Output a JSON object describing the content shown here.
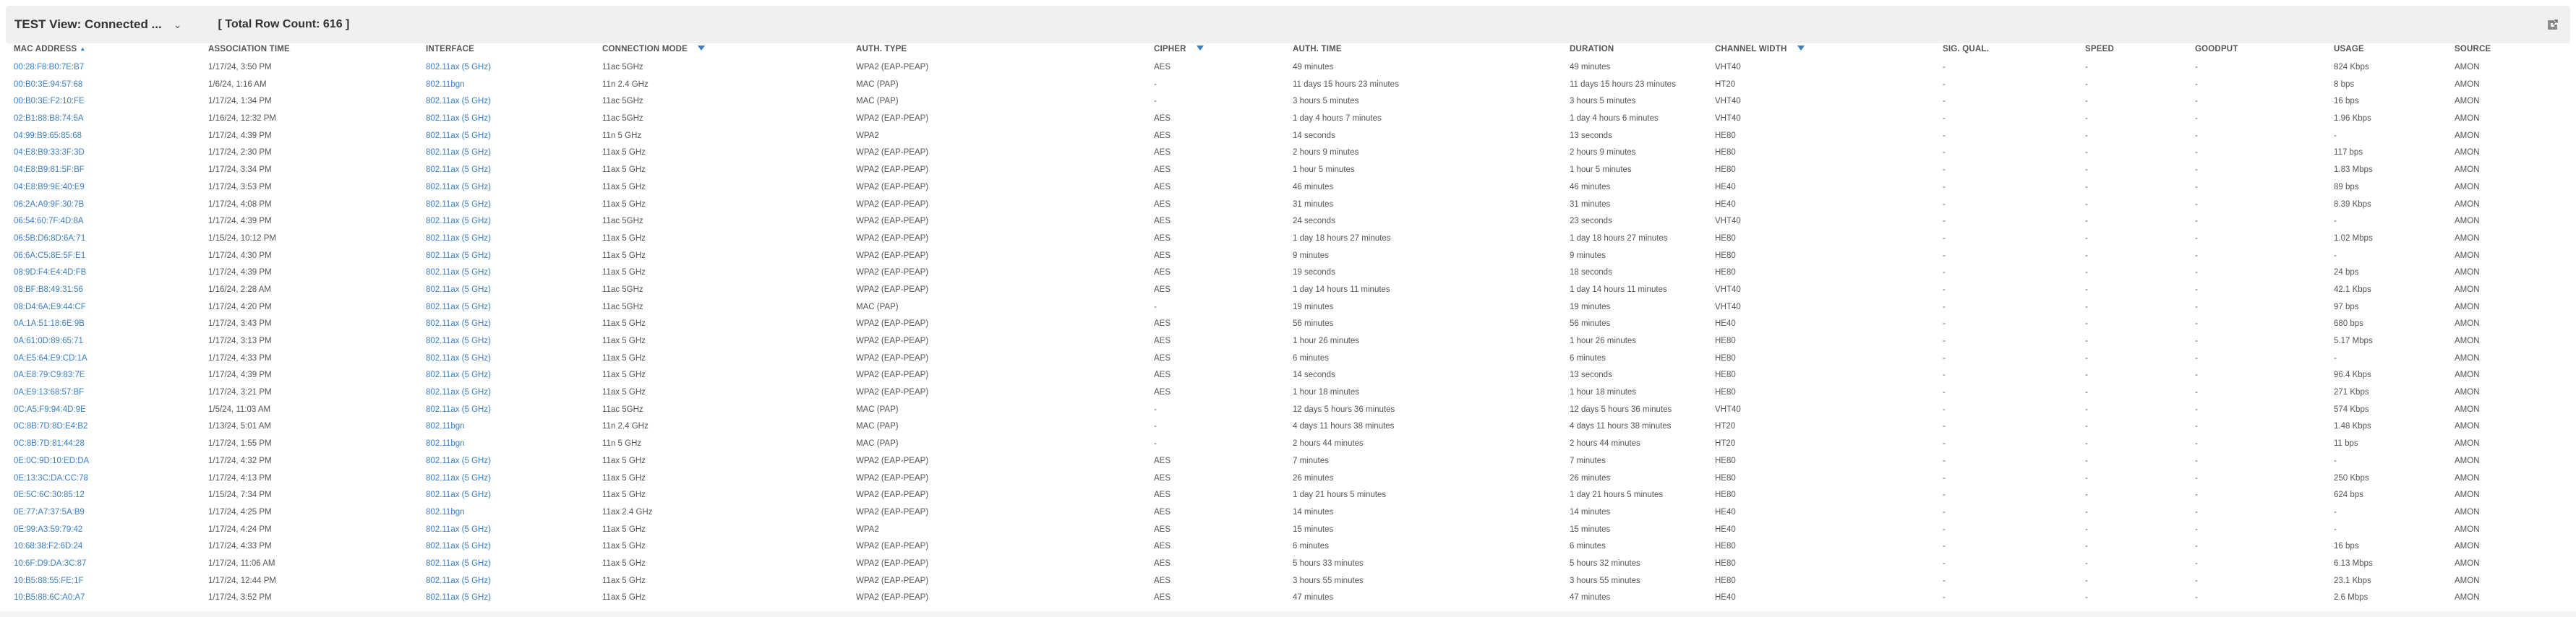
{
  "toolbar": {
    "view_name": "TEST View: Connected ...",
    "dropdown_glyph": "⌄",
    "row_count": "[ Total Row Count: 616 ]"
  },
  "table": {
    "columns": [
      "MAC ADDRESS",
      "ASSOCIATION TIME",
      "INTERFACE",
      "CONNECTION MODE",
      "AUTH. TYPE",
      "CIPHER",
      "AUTH. TIME",
      "DURATION",
      "CHANNEL WIDTH",
      "SIG. QUAL.",
      "SPEED",
      "GOODPUT",
      "USAGE",
      "SOURCE"
    ],
    "rows": [
      [
        "00:28:F8:B0:7E:B7",
        "1/17/24, 3:50 PM",
        "802.11ax (5 GHz)",
        "11ac 5GHz",
        "WPA2 (EAP-PEAP)",
        "AES",
        "49 minutes",
        "49 minutes",
        "VHT40",
        "-",
        "-",
        "-",
        "824 Kbps",
        "AMON"
      ],
      [
        "00:B0:3E:94:57:68",
        "1/6/24, 1:16 AM",
        "802.11bgn",
        "11n 2.4 GHz",
        "MAC (PAP)",
        "-",
        "11 days 15 hours 23 minutes",
        "11 days 15 hours 23 minutes",
        "HT20",
        "-",
        "-",
        "-",
        "8 bps",
        "AMON"
      ],
      [
        "00:B0:3E:F2:10:FE",
        "1/17/24, 1:34 PM",
        "802.11ax (5 GHz)",
        "11ac 5GHz",
        "MAC (PAP)",
        "-",
        "3 hours 5 minutes",
        "3 hours 5 minutes",
        "VHT40",
        "-",
        "-",
        "-",
        "16 bps",
        "AMON"
      ],
      [
        "02:B1:88:B8:74:5A",
        "1/16/24, 12:32 PM",
        "802.11ax (5 GHz)",
        "11ac 5GHz",
        "WPA2 (EAP-PEAP)",
        "AES",
        "1 day 4 hours 7 minutes",
        "1 day 4 hours 6 minutes",
        "VHT40",
        "-",
        "-",
        "-",
        "1.96 Kbps",
        "AMON"
      ],
      [
        "04:99:B9:65:85:68",
        "1/17/24, 4:39 PM",
        "802.11ax (5 GHz)",
        "11n 5 GHz",
        "WPA2",
        "AES",
        "14 seconds",
        "13 seconds",
        "HE80",
        "-",
        "-",
        "-",
        "-",
        "AMON"
      ],
      [
        "04:E8:B9:33:3F:3D",
        "1/17/24, 2:30 PM",
        "802.11ax (5 GHz)",
        "11ax 5 GHz",
        "WPA2 (EAP-PEAP)",
        "AES",
        "2 hours 9 minutes",
        "2 hours 9 minutes",
        "HE80",
        "-",
        "-",
        "-",
        "117 bps",
        "AMON"
      ],
      [
        "04:E8:B9:81:5F:BF",
        "1/17/24, 3:34 PM",
        "802.11ax (5 GHz)",
        "11ax 5 GHz",
        "WPA2 (EAP-PEAP)",
        "AES",
        "1 hour 5 minutes",
        "1 hour 5 minutes",
        "HE80",
        "-",
        "-",
        "-",
        "1.83 Mbps",
        "AMON"
      ],
      [
        "04:E8:B9:9E:40:E9",
        "1/17/24, 3:53 PM",
        "802.11ax (5 GHz)",
        "11ax 5 GHz",
        "WPA2 (EAP-PEAP)",
        "AES",
        "46 minutes",
        "46 minutes",
        "HE40",
        "-",
        "-",
        "-",
        "89 bps",
        "AMON"
      ],
      [
        "06:2A:A9:9F:30:7B",
        "1/17/24, 4:08 PM",
        "802.11ax (5 GHz)",
        "11ax 5 GHz",
        "WPA2 (EAP-PEAP)",
        "AES",
        "31 minutes",
        "31 minutes",
        "HE40",
        "-",
        "-",
        "-",
        "8.39 Kbps",
        "AMON"
      ],
      [
        "06:54:60:7F:4D:8A",
        "1/17/24, 4:39 PM",
        "802.11ax (5 GHz)",
        "11ac 5GHz",
        "WPA2 (EAP-PEAP)",
        "AES",
        "24 seconds",
        "23 seconds",
        "VHT40",
        "-",
        "-",
        "-",
        "-",
        "AMON"
      ],
      [
        "06:5B:D6:8D:6A:71",
        "1/15/24, 10:12 PM",
        "802.11ax (5 GHz)",
        "11ax 5 GHz",
        "WPA2 (EAP-PEAP)",
        "AES",
        "1 day 18 hours 27 minutes",
        "1 day 18 hours 27 minutes",
        "HE80",
        "-",
        "-",
        "-",
        "1.02 Mbps",
        "AMON"
      ],
      [
        "06:6A:C5:8E:5F:E1",
        "1/17/24, 4:30 PM",
        "802.11ax (5 GHz)",
        "11ax 5 GHz",
        "WPA2 (EAP-PEAP)",
        "AES",
        "9 minutes",
        "9 minutes",
        "HE80",
        "-",
        "-",
        "-",
        "-",
        "AMON"
      ],
      [
        "08:9D:F4:E4:4D:FB",
        "1/17/24, 4:39 PM",
        "802.11ax (5 GHz)",
        "11ax 5 GHz",
        "WPA2 (EAP-PEAP)",
        "AES",
        "19 seconds",
        "18 seconds",
        "HE80",
        "-",
        "-",
        "-",
        "24 bps",
        "AMON"
      ],
      [
        "08:BF:B8:49:31:56",
        "1/16/24, 2:28 AM",
        "802.11ax (5 GHz)",
        "11ac 5GHz",
        "WPA2 (EAP-PEAP)",
        "AES",
        "1 day 14 hours 11 minutes",
        "1 day 14 hours 11 minutes",
        "VHT40",
        "-",
        "-",
        "-",
        "42.1 Kbps",
        "AMON"
      ],
      [
        "08:D4:6A:E9:44:CF",
        "1/17/24, 4:20 PM",
        "802.11ax (5 GHz)",
        "11ac 5GHz",
        "MAC (PAP)",
        "-",
        "19 minutes",
        "19 minutes",
        "VHT40",
        "-",
        "-",
        "-",
        "97 bps",
        "AMON"
      ],
      [
        "0A:1A:51:18:6E:9B",
        "1/17/24, 3:43 PM",
        "802.11ax (5 GHz)",
        "11ax 5 GHz",
        "WPA2 (EAP-PEAP)",
        "AES",
        "56 minutes",
        "56 minutes",
        "HE40",
        "-",
        "-",
        "-",
        "680 bps",
        "AMON"
      ],
      [
        "0A:61:0D:89:65:71",
        "1/17/24, 3:13 PM",
        "802.11ax (5 GHz)",
        "11ax 5 GHz",
        "WPA2 (EAP-PEAP)",
        "AES",
        "1 hour 26 minutes",
        "1 hour 26 minutes",
        "HE80",
        "-",
        "-",
        "-",
        "5.17 Mbps",
        "AMON"
      ],
      [
        "0A:E5:64:E9:CD:1A",
        "1/17/24, 4:33 PM",
        "802.11ax (5 GHz)",
        "11ax 5 GHz",
        "WPA2 (EAP-PEAP)",
        "AES",
        "6 minutes",
        "6 minutes",
        "HE80",
        "-",
        "-",
        "-",
        "-",
        "AMON"
      ],
      [
        "0A:E8:79:C9:83:7E",
        "1/17/24, 4:39 PM",
        "802.11ax (5 GHz)",
        "11ax 5 GHz",
        "WPA2 (EAP-PEAP)",
        "AES",
        "14 seconds",
        "13 seconds",
        "HE80",
        "-",
        "-",
        "-",
        "96.4 Kbps",
        "AMON"
      ],
      [
        "0A:E9:13:68:57:BF",
        "1/17/24, 3:21 PM",
        "802.11ax (5 GHz)",
        "11ax 5 GHz",
        "WPA2 (EAP-PEAP)",
        "AES",
        "1 hour 18 minutes",
        "1 hour 18 minutes",
        "HE80",
        "-",
        "-",
        "-",
        "271 Kbps",
        "AMON"
      ],
      [
        "0C:A5:F9:94:4D:9E",
        "1/5/24, 11:03 AM",
        "802.11ax (5 GHz)",
        "11ac 5GHz",
        "MAC (PAP)",
        "-",
        "12 days 5 hours 36 minutes",
        "12 days 5 hours 36 minutes",
        "VHT40",
        "-",
        "-",
        "-",
        "574 Kbps",
        "AMON"
      ],
      [
        "0C:8B:7D:8D:E4:B2",
        "1/13/24, 5:01 AM",
        "802.11bgn",
        "11n 2.4 GHz",
        "MAC (PAP)",
        "-",
        "4 days 11 hours 38 minutes",
        "4 days 11 hours 38 minutes",
        "HT20",
        "-",
        "-",
        "-",
        "1.48 Kbps",
        "AMON"
      ],
      [
        "0C:8B:7D:81:44:28",
        "1/17/24, 1:55 PM",
        "802.11bgn",
        "11n 5 GHz",
        "MAC (PAP)",
        "-",
        "2 hours 44 minutes",
        "2 hours 44 minutes",
        "HT20",
        "-",
        "-",
        "-",
        "11 bps",
        "AMON"
      ],
      [
        "0E:0C:9D:10:ED:DA",
        "1/17/24, 4:32 PM",
        "802.11ax (5 GHz)",
        "11ax 5 GHz",
        "WPA2 (EAP-PEAP)",
        "AES",
        "7 minutes",
        "7 minutes",
        "HE80",
        "-",
        "-",
        "-",
        "-",
        "AMON"
      ],
      [
        "0E:13:3C:DA:CC:78",
        "1/17/24, 4:13 PM",
        "802.11ax (5 GHz)",
        "11ax 5 GHz",
        "WPA2 (EAP-PEAP)",
        "AES",
        "26 minutes",
        "26 minutes",
        "HE80",
        "-",
        "-",
        "-",
        "250 Kbps",
        "AMON"
      ],
      [
        "0E:5C:6C:30:85:12",
        "1/15/24, 7:34 PM",
        "802.11ax (5 GHz)",
        "11ax 5 GHz",
        "WPA2 (EAP-PEAP)",
        "AES",
        "1 day 21 hours 5 minutes",
        "1 day 21 hours 5 minutes",
        "HE80",
        "-",
        "-",
        "-",
        "624 bps",
        "AMON"
      ],
      [
        "0E:77:A7:37:5A:B9",
        "1/17/24, 4:25 PM",
        "802.11bgn",
        "11ax 2.4 GHz",
        "WPA2 (EAP-PEAP)",
        "AES",
        "14 minutes",
        "14 minutes",
        "HE40",
        "-",
        "-",
        "-",
        "-",
        "AMON"
      ],
      [
        "0E:99:A3:59:79:42",
        "1/17/24, 4:24 PM",
        "802.11ax (5 GHz)",
        "11ax 5 GHz",
        "WPA2",
        "AES",
        "15 minutes",
        "15 minutes",
        "HE40",
        "-",
        "-",
        "-",
        "-",
        "AMON"
      ],
      [
        "10:68:38:F2:6D:24",
        "1/17/24, 4:33 PM",
        "802.11ax (5 GHz)",
        "11ax 5 GHz",
        "WPA2 (EAP-PEAP)",
        "AES",
        "6 minutes",
        "6 minutes",
        "HE80",
        "-",
        "-",
        "-",
        "16 bps",
        "AMON"
      ],
      [
        "10:6F:D9:DA:3C:87",
        "1/17/24, 11:06 AM",
        "802.11ax (5 GHz)",
        "11ax 5 GHz",
        "WPA2 (EAP-PEAP)",
        "AES",
        "5 hours 33 minutes",
        "5 hours 32 minutes",
        "HE80",
        "-",
        "-",
        "-",
        "6.13 Mbps",
        "AMON"
      ],
      [
        "10:B5:88:55:FE:1F",
        "1/17/24, 12:44 PM",
        "802.11ax (5 GHz)",
        "11ax 5 GHz",
        "WPA2 (EAP-PEAP)",
        "AES",
        "3 hours 55 minutes",
        "3 hours 55 minutes",
        "HE80",
        "-",
        "-",
        "-",
        "23.1 Kbps",
        "AMON"
      ],
      [
        "10:B5:88:6C:A0:A7",
        "1/17/24, 3:52 PM",
        "802.11ax (5 GHz)",
        "11ax 5 GHz",
        "WPA2 (EAP-PEAP)",
        "AES",
        "47 minutes",
        "47 minutes",
        "HE40",
        "-",
        "-",
        "-",
        "2.6 Mbps",
        "AMON"
      ]
    ]
  },
  "colors": {
    "link": "#3a7fc4",
    "toolbar_bg": "#f0f0f0",
    "text": "#555555"
  },
  "icons": {
    "export": "export-icon",
    "sort": "sort-ascending-icon",
    "filter": "filter-icon"
  }
}
